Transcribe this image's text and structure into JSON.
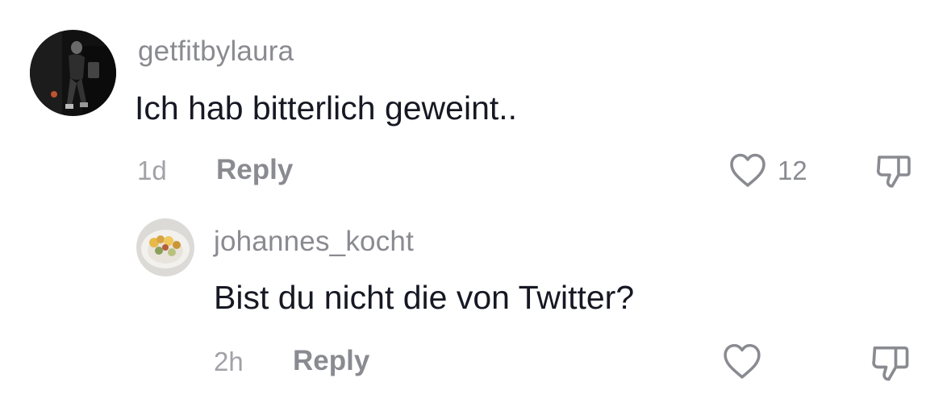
{
  "comments": [
    {
      "username": "getfitbylaura",
      "text": "Ich hab bitterlich geweint..",
      "time": "1d",
      "reply_label": "Reply",
      "like_count": "12",
      "like_icon": "heart-outline-icon",
      "dislike_icon": "thumbs-down-icon"
    },
    {
      "username": "johannes_kocht",
      "text": "Bist du nicht die von Twitter?",
      "time": "2h",
      "reply_label": "Reply",
      "like_count": "",
      "like_icon": "heart-outline-icon",
      "dislike_icon": "thumbs-down-icon"
    }
  ],
  "colors": {
    "username": "#8a8b91",
    "text": "#161823",
    "meta": "#a1a2a7",
    "icon": "#8a8b91"
  }
}
